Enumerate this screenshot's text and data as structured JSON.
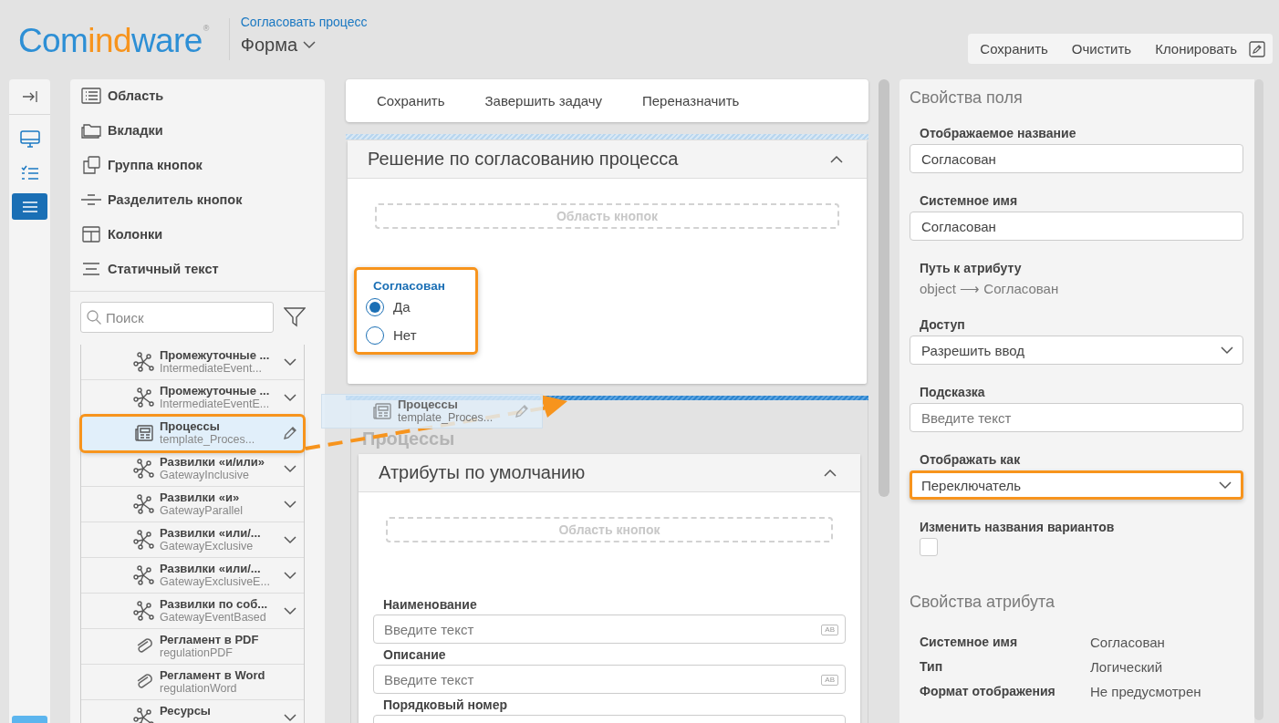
{
  "header": {
    "logo": [
      {
        "text": "Com",
        "color": "#2d8fd5"
      },
      {
        "text": "ind",
        "color": "#f7941d"
      },
      {
        "text": "ware",
        "color": "#2d8fd5"
      }
    ],
    "logo_mark": "®",
    "breadcrumb": "Согласовать процесс",
    "title": "Форма",
    "actions": [
      "Сохранить",
      "Очистить",
      "Клонировать"
    ]
  },
  "rail": {
    "items": [
      {
        "kind": "collapse",
        "selected": false
      },
      {
        "kind": "desktop",
        "selected": false
      },
      {
        "kind": "checklist",
        "selected": false
      },
      {
        "kind": "menu",
        "selected": true
      }
    ]
  },
  "palette": {
    "elements": [
      {
        "kind": "area",
        "label": "Область"
      },
      {
        "kind": "tabs",
        "label": "Вкладки"
      },
      {
        "kind": "button-group",
        "label": "Группа кнопок"
      },
      {
        "kind": "divider",
        "label": "Разделитель кнопок"
      },
      {
        "kind": "columns",
        "label": "Колонки"
      },
      {
        "kind": "text",
        "label": "Статичный текст"
      }
    ],
    "search": {
      "placeholder": "Поиск"
    },
    "attributes": [
      {
        "kind": "graph",
        "title": "Промежуточные ...",
        "subtitle": "IntermediateEvent...",
        "expandable": true,
        "selected": false
      },
      {
        "kind": "graph",
        "title": "Промежуточные ...",
        "subtitle": "IntermediateEventE...",
        "expandable": true,
        "selected": false
      },
      {
        "kind": "template",
        "title": "Процессы",
        "subtitle": "template_Proces...",
        "expandable": false,
        "selected": true
      },
      {
        "kind": "graph",
        "title": "Развилки «и/или»",
        "subtitle": "GatewayInclusive",
        "expandable": true,
        "selected": false
      },
      {
        "kind": "graph",
        "title": "Развилки «и»",
        "subtitle": "GatewayParallel",
        "expandable": true,
        "selected": false
      },
      {
        "kind": "graph",
        "title": "Развилки «или/...",
        "subtitle": "GatewayExclusive",
        "expandable": true,
        "selected": false
      },
      {
        "kind": "graph",
        "title": "Развилки «или/...",
        "subtitle": "GatewayExclusiveE...",
        "expandable": true,
        "selected": false
      },
      {
        "kind": "graph",
        "title": "Развилки по соб...",
        "subtitle": "GatewayEventBased",
        "expandable": true,
        "selected": false
      },
      {
        "kind": "attachment",
        "title": "Регламент в PDF",
        "subtitle": "regulationPDF",
        "expandable": false,
        "selected": false
      },
      {
        "kind": "attachment",
        "title": "Регламент в Word",
        "subtitle": "regulationWord",
        "expandable": false,
        "selected": false
      },
      {
        "kind": "graph",
        "title": "Ресурсы",
        "expandable": true,
        "selected": false
      }
    ]
  },
  "form": {
    "toolbar": [
      "Сохранить",
      "Завершить задачу",
      "Переназначить"
    ],
    "section": {
      "title": "Решение по согласованию процесса",
      "expanded": true,
      "button_area": "Область кнопок",
      "field": {
        "label": "Согласован",
        "highlighted": true,
        "options": [
          {
            "label": "Да",
            "selected": true
          },
          {
            "label": "Нет",
            "selected": false
          }
        ]
      }
    },
    "group_title": "Процессы",
    "subsection": {
      "title": "Атрибуты по умолчанию",
      "expanded": true,
      "button_area": "Область кнопок",
      "fields": [
        {
          "label": "Наименование",
          "placeholder": "Введите текст",
          "badge": "AB"
        },
        {
          "label": "Описание",
          "placeholder": "Введите текст",
          "badge": "AB"
        },
        {
          "label": "Порядковый номер"
        }
      ]
    },
    "drag_ghost": {
      "title": "Процессы",
      "subtitle": "template_Proces..."
    }
  },
  "properties": {
    "title": "Свойства поля",
    "fields": [
      {
        "kind": "input",
        "label": "Отображаемое название",
        "value": "Согласован"
      },
      {
        "kind": "input",
        "label": "Системное имя",
        "value": "Согласован"
      },
      {
        "kind": "path",
        "label": "Путь к атрибуту",
        "value": "object ⟶ Согласован"
      },
      {
        "kind": "select",
        "label": "Доступ",
        "value": "Разрешить ввод",
        "highlighted": false
      },
      {
        "kind": "input",
        "label": "Подсказка",
        "placeholder": "Введите текст"
      },
      {
        "kind": "select",
        "label": "Отображать как",
        "value": "Переключатель",
        "highlighted": true
      },
      {
        "kind": "checkbox",
        "label": "Изменить названия вариантов",
        "checked": false
      }
    ],
    "attribute_title": "Свойства атрибута",
    "attribute_rows": [
      {
        "name": "Системное имя",
        "value": "Согласован"
      },
      {
        "name": "Тип",
        "value": "Логический"
      },
      {
        "name": "Формат отображения",
        "value": "Не предусмотрен"
      }
    ]
  }
}
